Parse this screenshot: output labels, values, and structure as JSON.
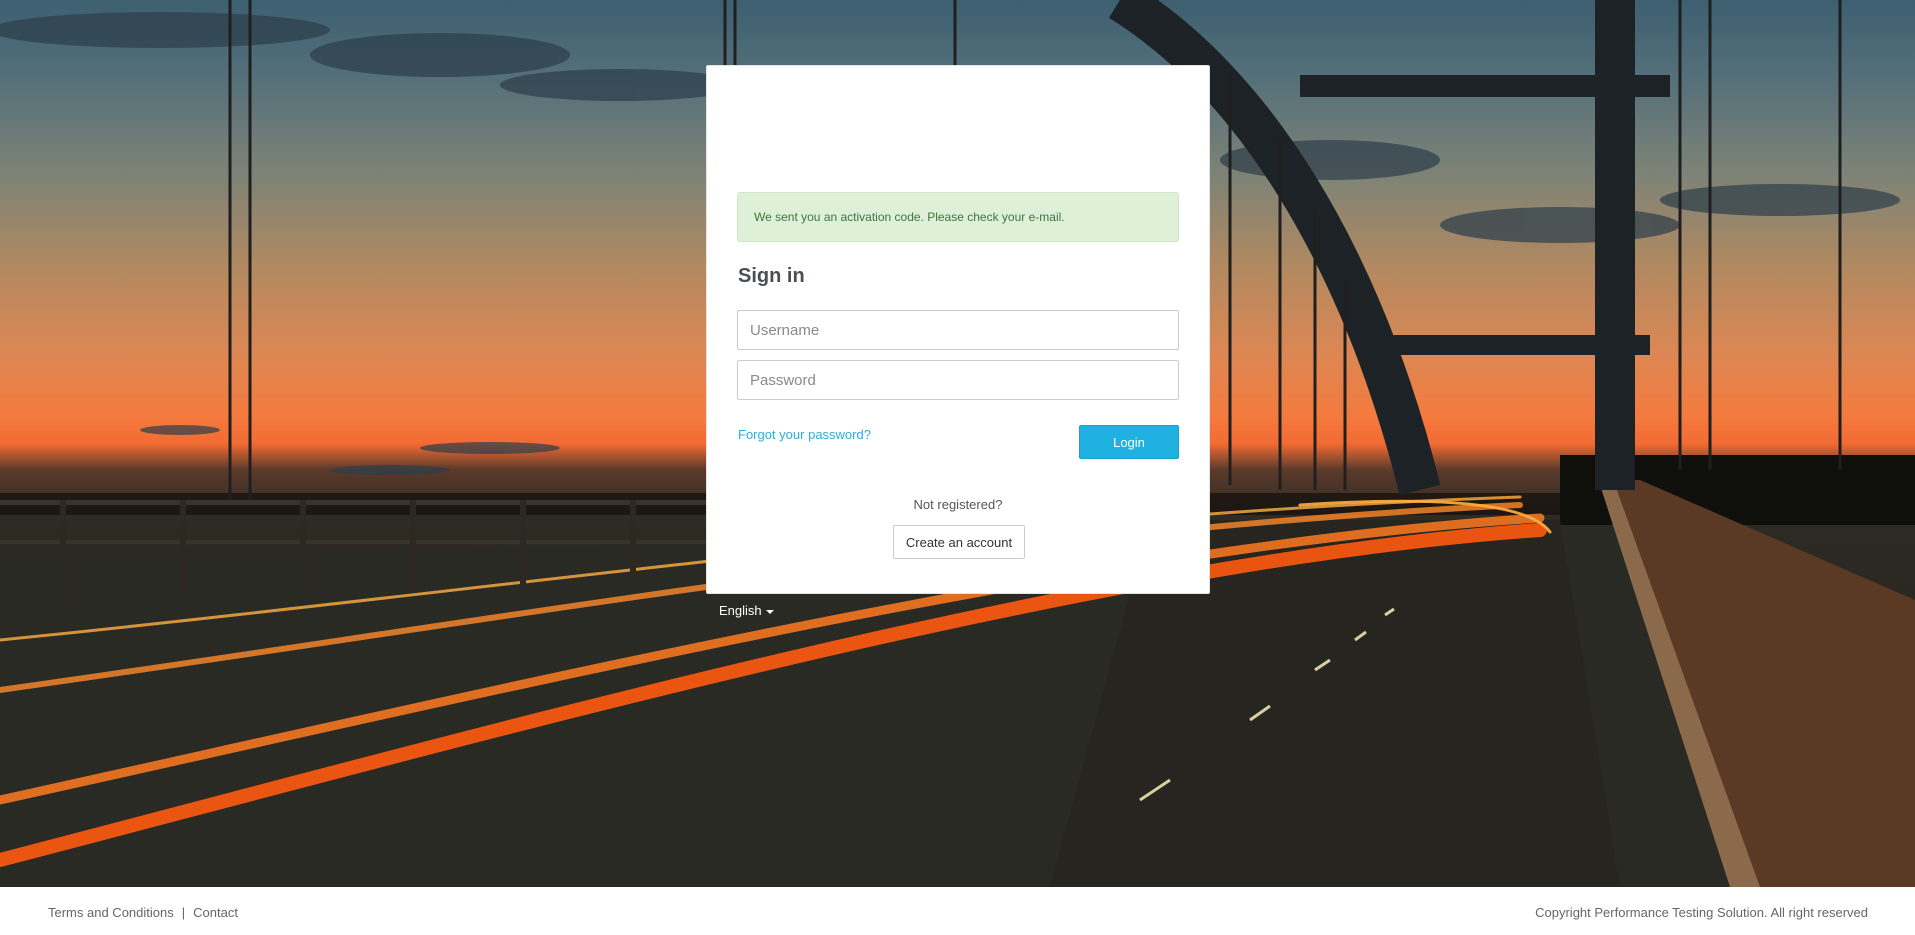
{
  "alert": {
    "message": "We sent you an activation code. Please check your e-mail."
  },
  "form": {
    "title": "Sign in",
    "username_placeholder": "Username",
    "password_placeholder": "Password",
    "forgot_label": "Forgot your password?",
    "login_label": "Login",
    "not_registered": "Not registered?",
    "create_account_label": "Create an account"
  },
  "language": {
    "selected": "English"
  },
  "footer": {
    "terms": "Terms and Conditions",
    "separator": "|",
    "contact": "Contact",
    "copyright": "Copyright Performance Testing Solution. All right reserved"
  },
  "colors": {
    "accent": "#1fb2e0",
    "link": "#2aaee0",
    "alert_bg": "#dff0d8",
    "alert_text": "#3c763d"
  }
}
